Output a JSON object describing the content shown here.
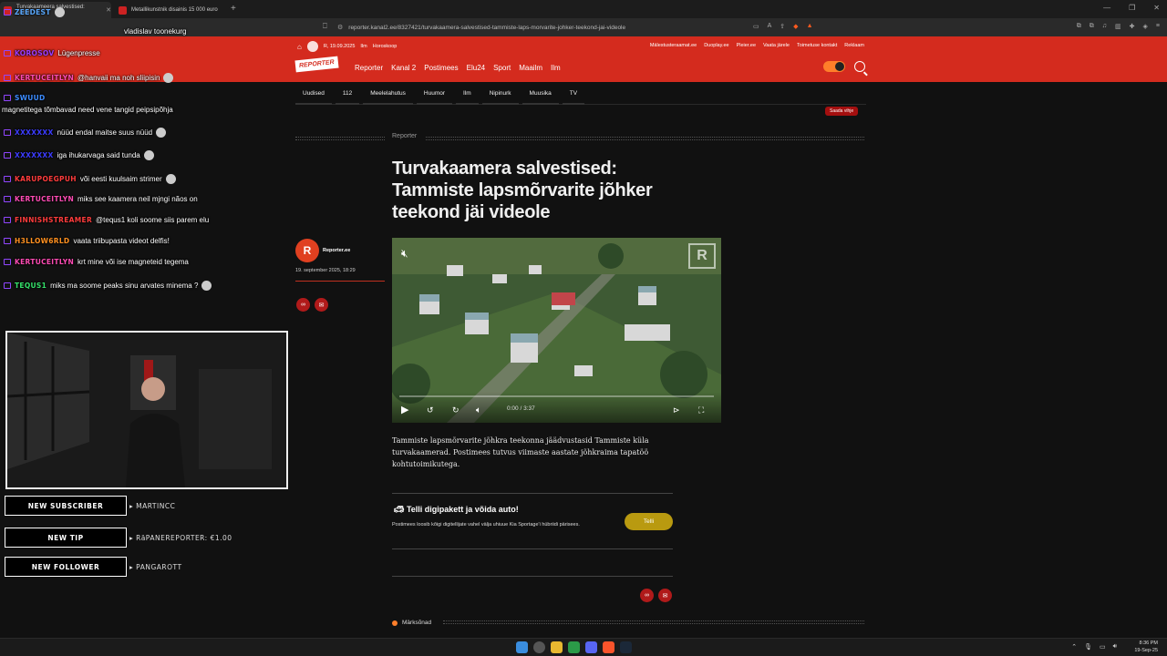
{
  "browser": {
    "tabs": [
      {
        "label": "Turvakaameera salvestised: Tamm"
      },
      {
        "label": "Metallikunstnik disainis 15 000 euro"
      }
    ],
    "url": "reporter.kanal2.ee/8327421/turvakaamera-salvestised-tammiste-laps-morvarite-johker-teekond-jai-videole"
  },
  "site": {
    "util": {
      "date": "R, 19.09.2025",
      "weather": "Ilm",
      "horoscope": "Horoskoop"
    },
    "util_right": [
      "Mälestusteraamat.ee",
      "Duoplay.ee",
      "Pleier.ee",
      "Vaata järele",
      "Toimetuse kontakt",
      "Reklaam"
    ],
    "logo": "REPORTER",
    "main_nav": [
      "Reporter",
      "Kanal 2",
      "Postimees",
      "Elu24",
      "Sport",
      "Maailm",
      "Ilm"
    ],
    "sub_nav": [
      "Uudised",
      "112",
      "Meelelahutus",
      "Huumor",
      "Ilm",
      "Nipinurk",
      "Muusika",
      "TV"
    ],
    "send_video": "Saada vihje"
  },
  "article": {
    "section": "Reporter",
    "headline": "Turvakaamera salvestised: Tammiste lapsmõrvarite jõhker teekond jäi videole",
    "author": "Reporter.ee",
    "author_initial": "R",
    "date": "19. september 2025, 18:29",
    "video_time": "0:00 / 3:37",
    "lede": "Tammiste lapsmõrvarite jõhkra teekonna jäädvustasid Tammiste küla turvakaamerad. Postimees tutvus viimaste aastate jõhkraima tapatöö kohtutoimikutega.",
    "promo_title": "Telli digipakett ja võida auto!",
    "promo_desc": "Postimees loosib kõigi digitellijate vahel välja uhiuue Kia Sportage'i hübriidi pärisees.",
    "promo_button": "Telli",
    "keywords_label": "Märksõnad"
  },
  "chat": [
    {
      "user": "ZEEDEST",
      "text": "",
      "color": "#5aa9ff"
    },
    {
      "user": "",
      "text": "vladislav toonekurg",
      "color": "#ff3c3c"
    },
    {
      "user": "KOROSOV",
      "text": "Lügenpresse",
      "color": "#9a3cff"
    },
    {
      "user": "KERTUCEITLYN",
      "text": "@hanvaii ma noh sliipisin",
      "color": "#ff4bb4"
    },
    {
      "user": "SWUUD",
      "text": "",
      "color": "#3c8cff"
    },
    {
      "user": "",
      "text": "magnetitega tõmbavad need vene tangid peipsipõhja",
      "color": "#fff"
    },
    {
      "user": "XXXXXXX",
      "text": "nüüd endal maitse suus nüüd",
      "color": "#3c3cff"
    },
    {
      "user": "XXXXXXX",
      "text": "iga ihukarvaga said tunda",
      "color": "#3c3cff"
    },
    {
      "user": "KARUPOEGPUH",
      "text": "või eesti kuulsaim strimer",
      "color": "#ff3c3c"
    },
    {
      "user": "KERTUCEITLYN",
      "text": "miks see kaamera neil mjngi nãos on",
      "color": "#ff4bb4"
    },
    {
      "user": "FINNISHSTREAMER",
      "text": "@tequs1 koli soome siis parem elu",
      "color": "#ff3c3c"
    },
    {
      "user": "H3LLOW6RLD",
      "text": "vaata triibupasta videot delfis!",
      "color": "#ff9020"
    },
    {
      "user": "KERTUCEITLYN",
      "text": "krt mine või ise magneteid tegema",
      "color": "#ff4bb4"
    },
    {
      "user": "TEQUS1",
      "text": "miks ma soome peaks sinu arvates minema ?",
      "color": "#35e06a"
    }
  ],
  "alerts": [
    {
      "label": "NEW SUBSCRIBER",
      "value": "MARTINCC"
    },
    {
      "label": "NEW TIP",
      "value": "RäPANEREPORTER: €1.00"
    },
    {
      "label": "NEW FOLLOWER",
      "value": "PANGAROTT"
    }
  ],
  "taskbar": {
    "time": "8:36 PM",
    "date": "19-Sep-25"
  }
}
